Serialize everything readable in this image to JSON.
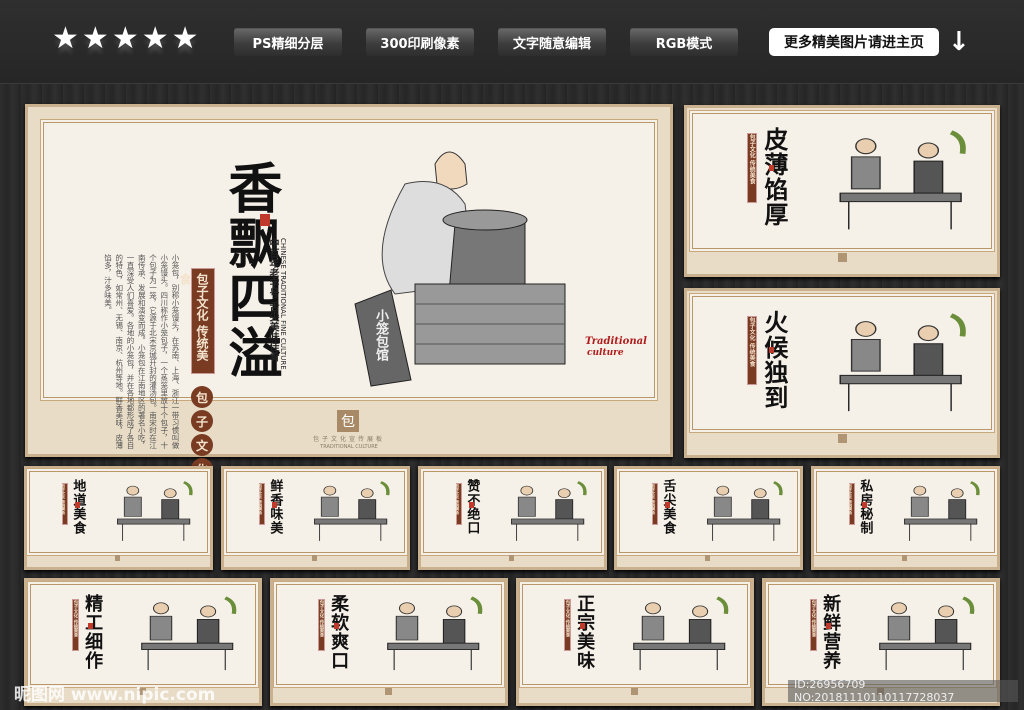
{
  "toolbar": {
    "stars": [
      "★",
      "★",
      "★",
      "★",
      "★"
    ],
    "buttons": [
      "PS精细分层",
      "300印刷像素",
      "文字随意编辑",
      "RGB模式"
    ],
    "more_label": "更多精美图片请进主页",
    "arrow": "↓"
  },
  "main_panel": {
    "title": "香飘四溢",
    "badge": "包子文化 传统美食",
    "circles": [
      "包",
      "子",
      "文",
      "化"
    ],
    "slogan": "中百年老字号 舌尖美味佳肴",
    "english": "CHINESE TRADITIONAL FINE CULTURE",
    "sign": "小笼包馆",
    "traditional": "Traditional",
    "culture": "culture",
    "footer_char": "包",
    "footer_text": "包子文化宣传展板",
    "footer_en": "TRADITIONAL CULTURE",
    "body": "小笼包，别称小笼馒头，在苏南、上海、浙江一带习惯叫做小笼馒头。四川称作小笼包子，一个蒸笼里放十个包子，十个包子为一笼，它源于北宋京城开封的灌汤包。南宋时在江南传承、发展和演变而成。小笼包在江南地区的著名小吃，一直深受人们喜爱。各地的小笼包，并在各地都形成了各自的特色，如常州、无锡、南京、杭州等地。鲜香美味，皮薄馅多，汁多味美。"
  },
  "side_panels": [
    {
      "title": "皮薄馅厚"
    },
    {
      "title": "火候独到"
    }
  ],
  "row_panels": [
    {
      "title": "地道美食"
    },
    {
      "title": "鲜香味美"
    },
    {
      "title": "赞不绝口"
    },
    {
      "title": "舌尖美食"
    },
    {
      "title": "私房秘制"
    },
    {
      "title": "精工细作"
    },
    {
      "title": "柔软爽口"
    },
    {
      "title": "正宗美味"
    },
    {
      "title": "新鲜营养"
    }
  ],
  "small_badge": "包子文化 传统美食",
  "small_circles": "包子文化",
  "watermark": "昵图网 www.nipic.com",
  "image_id": "ID:26956709 NO:20181110110117728037"
}
